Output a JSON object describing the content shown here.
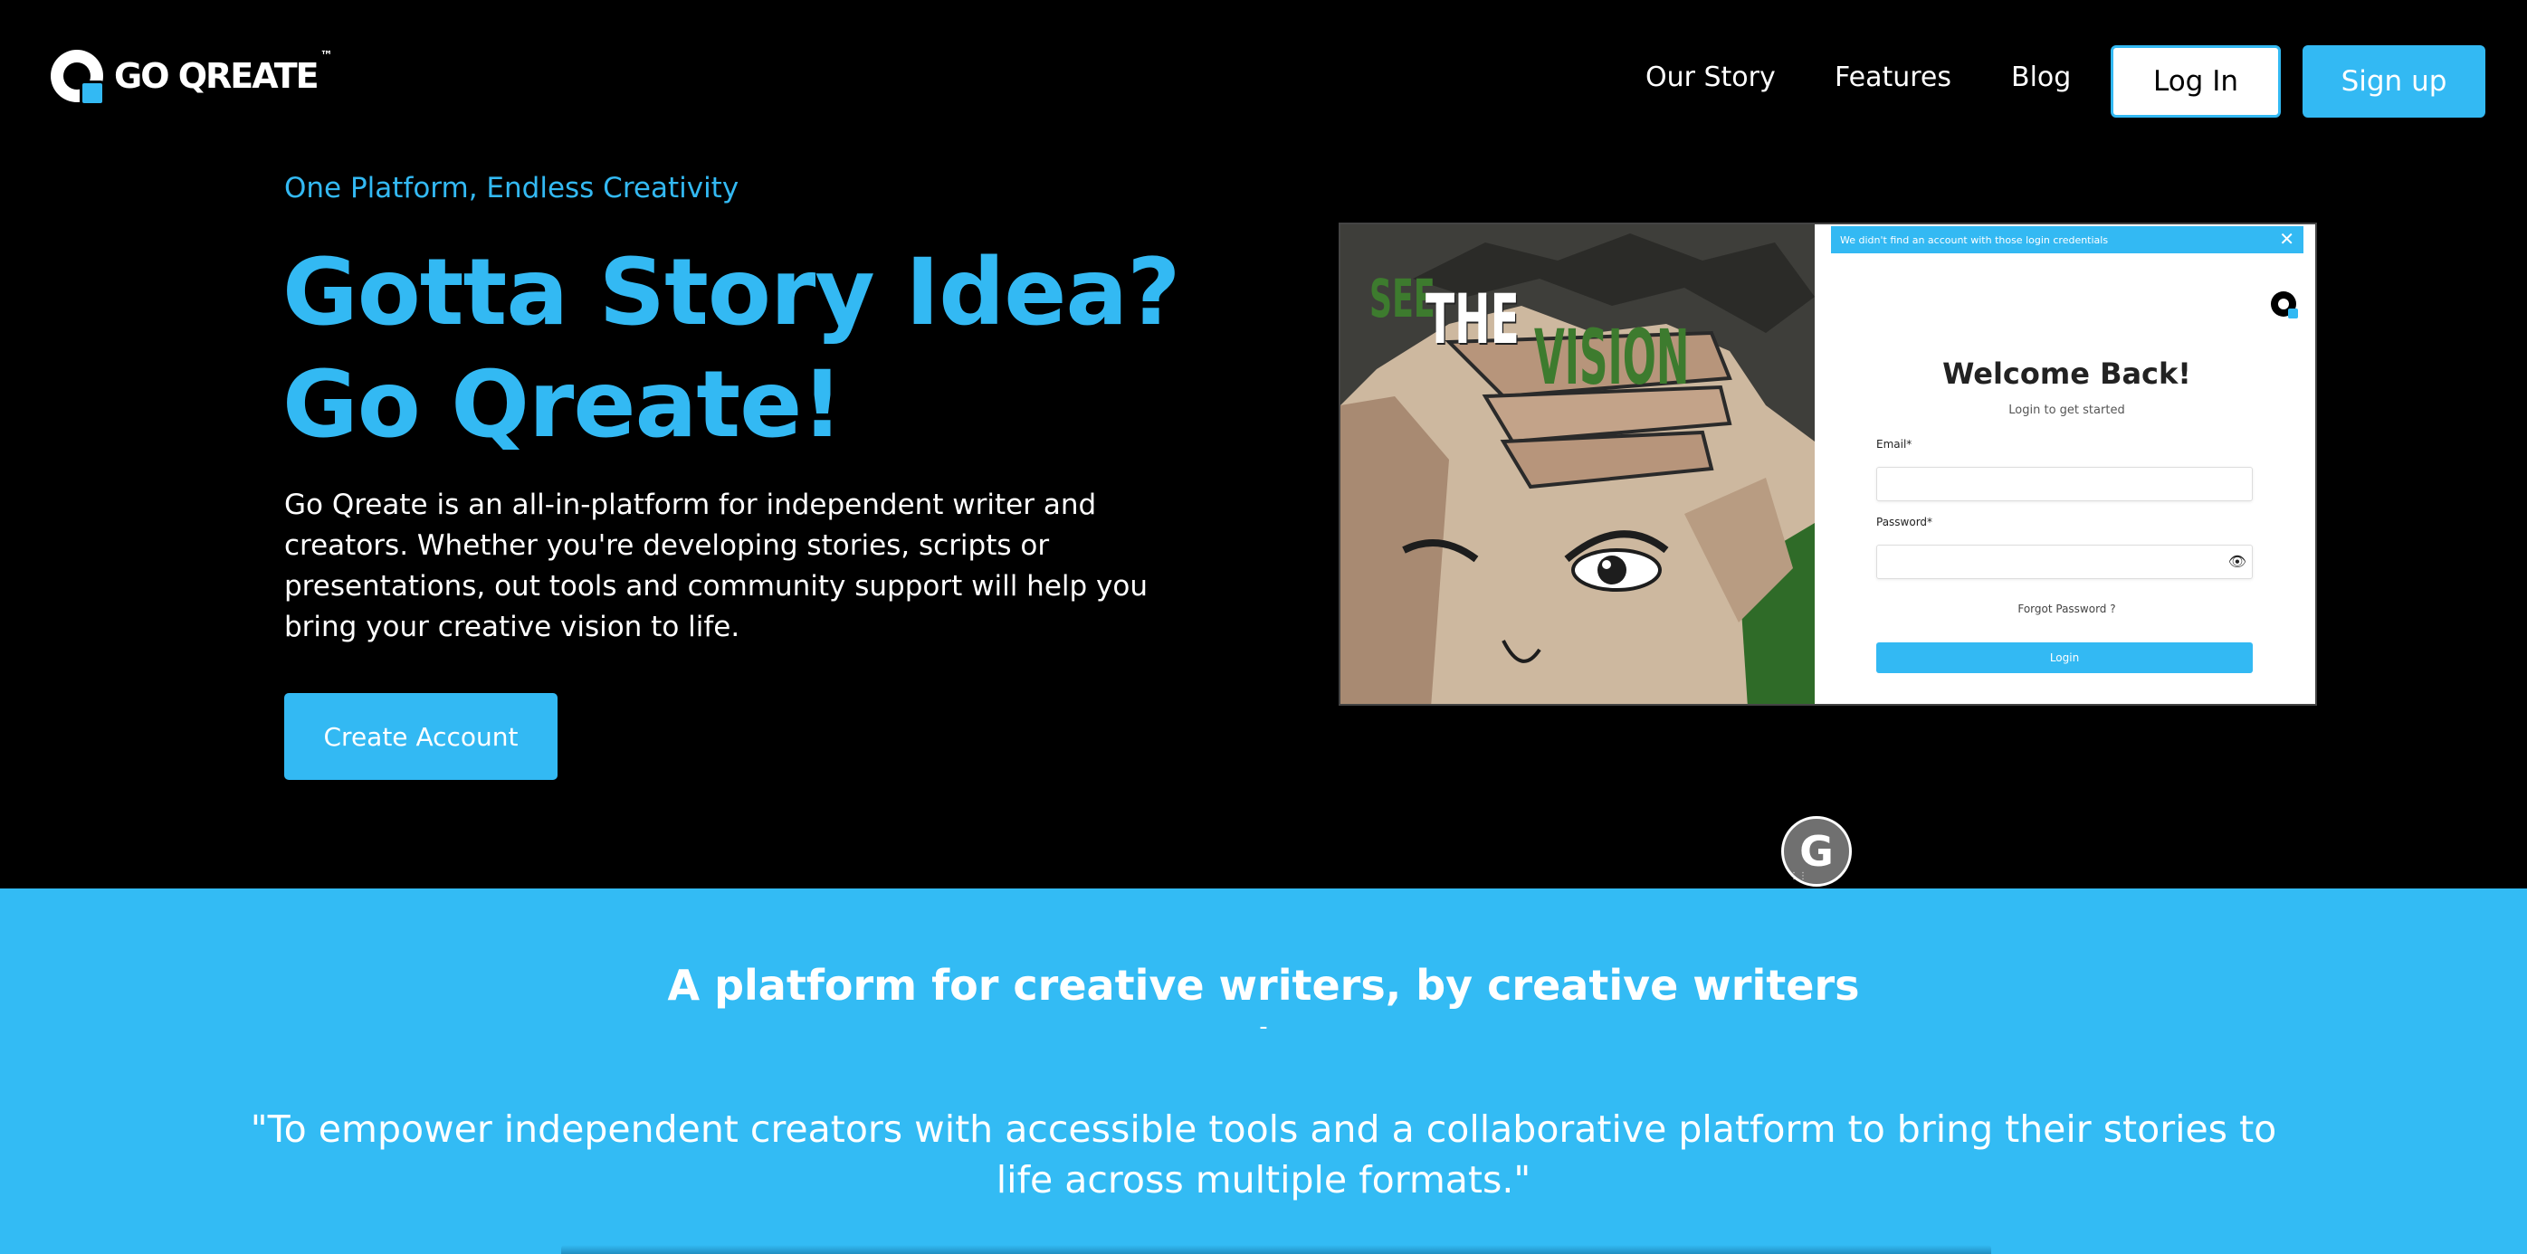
{
  "brand": {
    "name": "GO QREATE",
    "tm": "™",
    "accent": "#33b9f3"
  },
  "nav": {
    "links": [
      "Our Story",
      "Features",
      "Blog"
    ],
    "login_label": "Log In",
    "signup_label": "Sign up"
  },
  "hero": {
    "eyebrow": "One Platform, Endless Creativity",
    "headline_line1": "Gotta Story Idea?",
    "headline_line2": "Go Qreate!",
    "body": "Go Qreate is an all-in-platform for independent writer and creators. Whether you're developing stories, scripts or presentations, out tools and community support will help you bring your creative vision to life.",
    "cta_label": "Create Account"
  },
  "mockup": {
    "art_text": {
      "see": "SEE",
      "the": "THE",
      "vision": "VISION"
    },
    "alert": "We didn't find an account with those login credentials",
    "alert_close": "✕",
    "title": "Welcome Back!",
    "subtitle": "Login to get started",
    "email_label": "Email*",
    "password_label": "Password*",
    "eye_icon": "👁",
    "forgot": "Forgot Password ?",
    "login_button": "Login"
  },
  "widget": {
    "letter": "G"
  },
  "mission": {
    "title": "A platform for creative writers, by creative writers",
    "divider": "-",
    "quote": "\"To empower independent creators with accessible tools and a collaborative platform to bring their stories to life across multiple formats.\""
  }
}
